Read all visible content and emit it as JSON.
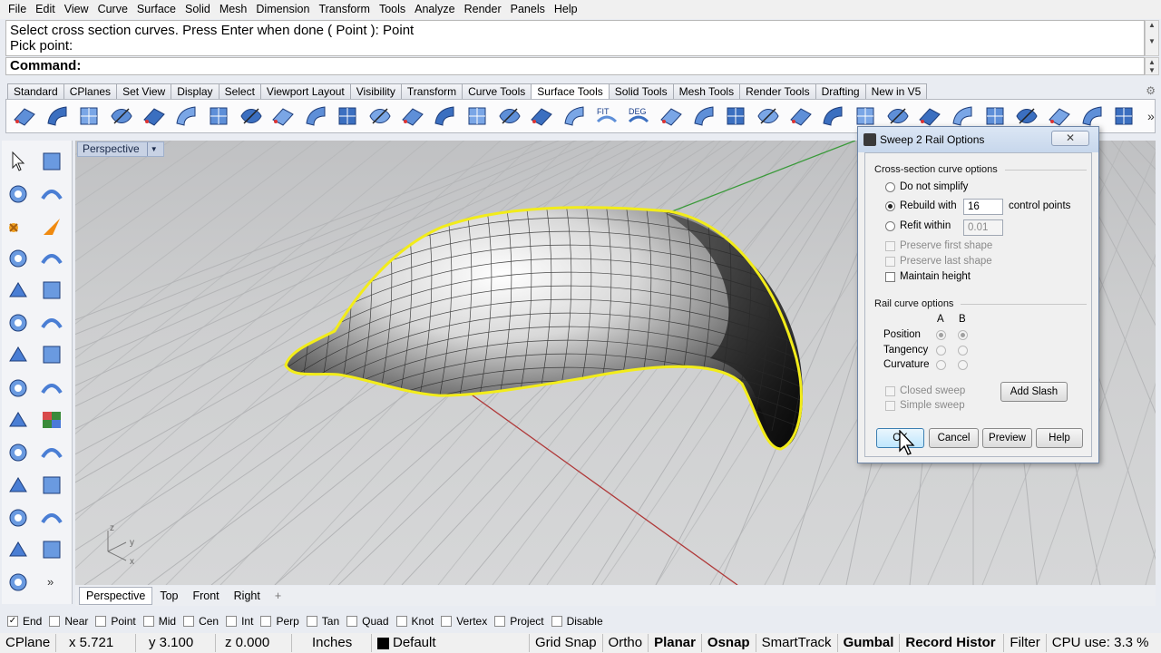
{
  "menu": [
    "File",
    "Edit",
    "View",
    "Curve",
    "Surface",
    "Solid",
    "Mesh",
    "Dimension",
    "Transform",
    "Tools",
    "Analyze",
    "Render",
    "Panels",
    "Help"
  ],
  "command": {
    "history_line1": "Select cross section curves. Press Enter when done ( Point ): Point",
    "history_line2": "Pick point:",
    "prompt": "Command:"
  },
  "toolbar_tabs": [
    "Standard",
    "CPlanes",
    "Set View",
    "Display",
    "Select",
    "Viewport Layout",
    "Visibility",
    "Transform",
    "Curve Tools",
    "Surface Tools",
    "Solid Tools",
    "Mesh Tools",
    "Render Tools",
    "Drafting",
    "New in V5"
  ],
  "active_toolbar_tab": "Surface Tools",
  "toolbar_icon_texts": {
    "fit": "FIT",
    "deg": "DEG"
  },
  "viewport": {
    "label": "Perspective",
    "axis_labels": {
      "z": "z",
      "y": "y",
      "x": "x"
    }
  },
  "viewport_tabs": [
    "Perspective",
    "Top",
    "Front",
    "Right",
    "+"
  ],
  "osnaps": [
    {
      "label": "End",
      "checked": true
    },
    {
      "label": "Near",
      "checked": false
    },
    {
      "label": "Point",
      "checked": false
    },
    {
      "label": "Mid",
      "checked": false
    },
    {
      "label": "Cen",
      "checked": false
    },
    {
      "label": "Int",
      "checked": false
    },
    {
      "label": "Perp",
      "checked": false
    },
    {
      "label": "Tan",
      "checked": false
    },
    {
      "label": "Quad",
      "checked": false
    },
    {
      "label": "Knot",
      "checked": false
    },
    {
      "label": "Vertex",
      "checked": false
    },
    {
      "label": "Project",
      "checked": false
    },
    {
      "label": "Disable",
      "checked": false
    }
  ],
  "status": {
    "cplane": "CPlane",
    "x": "x 5.721",
    "y": "y 3.100",
    "z": "z 0.000",
    "units": "Inches",
    "layer": "Default",
    "grid_snap": "Grid Snap",
    "ortho": "Ortho",
    "planar": "Planar",
    "osnap": "Osnap",
    "smarttrack": "SmartTrack",
    "gumball": "Gumbal",
    "record_history": "Record Histor",
    "filter": "Filter",
    "cpu": "CPU use: 3.3 %"
  },
  "dialog": {
    "title": "Sweep 2 Rail Options",
    "close": "✕",
    "cross_section_group": "Cross-section curve options",
    "do_not_simplify": "Do not simplify",
    "rebuild_with": "Rebuild with",
    "rebuild_value": "16",
    "control_points": "control points",
    "refit_within": "Refit within",
    "refit_value": "0.01",
    "preserve_first": "Preserve first shape",
    "preserve_last": "Preserve last shape",
    "maintain_height": "Maintain height",
    "rail_group": "Rail curve options",
    "col_a": "A",
    "col_b": "B",
    "position": "Position",
    "tangency": "Tangency",
    "curvature": "Curvature",
    "closed_sweep": "Closed sweep",
    "simple_sweep": "Simple sweep",
    "add_slash": "Add Slash",
    "ok": "OK",
    "cancel": "Cancel",
    "preview": "Preview",
    "help": "Help"
  },
  "colors": {
    "rail_highlight": "#f2ec1a",
    "viewport_bg": "#cdcecf",
    "grid_line": "#b4b5b7",
    "x_axis": "#b03a3a",
    "y_axis": "#3a9a3a"
  }
}
